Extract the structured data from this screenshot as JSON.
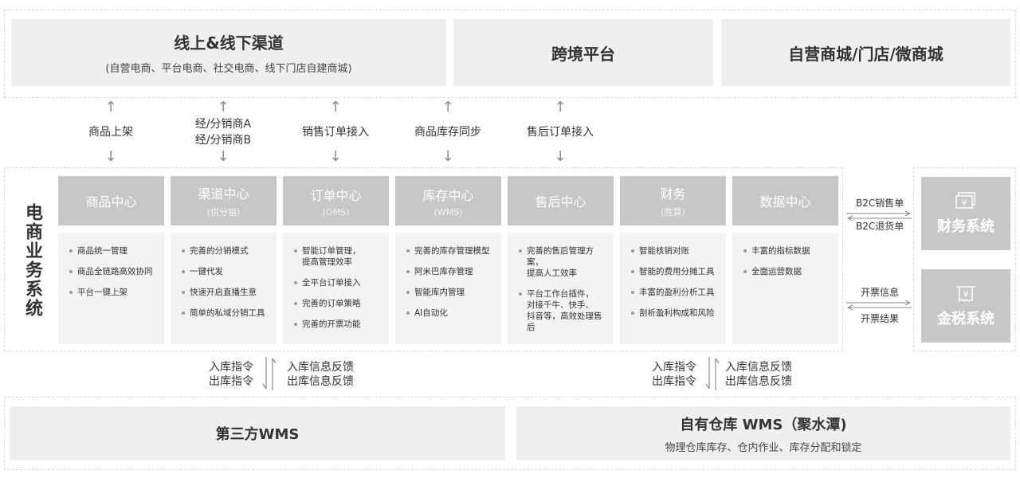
{
  "channels": {
    "online_offline": {
      "title": "线上&线下渠道",
      "subtitle": "(自营电商、平台电商、社交电商、线下门店自建商城)"
    },
    "cross_border": {
      "title": "跨境平台"
    },
    "own_mall": {
      "title": "自营商城/门店/微商城"
    }
  },
  "flows": [
    {
      "lines": [
        "商品上架"
      ]
    },
    {
      "lines": [
        "经/分销商A",
        "经/分销商B"
      ]
    },
    {
      "lines": [
        "销售订单接入"
      ]
    },
    {
      "lines": [
        "商品库存同步"
      ]
    },
    {
      "lines": [
        "售后订单接入"
      ]
    }
  ],
  "platform": {
    "title": "电商业务系统",
    "modules": [
      {
        "name": "商品中心",
        "sub": "",
        "items": [
          "商品统一管理",
          "商品全链路高效协同",
          "平台一键上架"
        ]
      },
      {
        "name": "渠道中心",
        "sub": "(供分销)",
        "items": [
          "完善的分销模式",
          "一键代发",
          "快速开启直播生意",
          "简单的私域分销工具"
        ]
      },
      {
        "name": "订单中心",
        "sub": "(OMS)",
        "items": [
          "智能订单管理，\n提高管理效率",
          "全平台订单接入",
          "完善的订单策略",
          "完善的开票功能"
        ]
      },
      {
        "name": "库存中心",
        "sub": "(WMS)",
        "items": [
          "完善的库存管理模型",
          "阿米巴库存管理",
          "智能库内管理",
          "AI自动化"
        ]
      },
      {
        "name": "售后中心",
        "sub": "",
        "items": [
          "完善的售后管理方案，\n提高人工效率",
          "平台工作台插件，\n对接千牛、快手、\n抖音等，高效处理售后"
        ]
      },
      {
        "name": "财务",
        "sub": "(胜算)",
        "items": [
          "智能核销对账",
          "智能的费用分摊工具",
          "丰富的盈利分析工具",
          "剖析盈利构成和风险"
        ]
      },
      {
        "name": "数据中心",
        "sub": "",
        "items": [
          "丰富的指标数据",
          "全面运营数据"
        ]
      }
    ]
  },
  "side_flows": {
    "finance": {
      "top": "B2C销售单",
      "bottom": "B2C退货单"
    },
    "tax": {
      "top": "开票信息",
      "bottom": "开票结果"
    }
  },
  "external": {
    "finance_system": {
      "name": "财务系统",
      "icon": "money-card-icon"
    },
    "tax_system": {
      "name": "金税系统",
      "icon": "receipt-icon"
    }
  },
  "wms_flows": {
    "left": {
      "down": [
        "入库指令",
        "出库指令"
      ],
      "up": [
        "入库信息反馈",
        "出库信息反馈"
      ]
    },
    "right": {
      "down": [
        "入库指令",
        "出库指令"
      ],
      "up": [
        "入库信息反馈",
        "出库信息反馈"
      ]
    }
  },
  "warehouses": {
    "third_party": {
      "title": "第三方WMS"
    },
    "own": {
      "title": "自有仓库 WMS（聚水潭)",
      "subtitle": "物理仓库库存、仓内作业、库存分配和锁定"
    }
  }
}
